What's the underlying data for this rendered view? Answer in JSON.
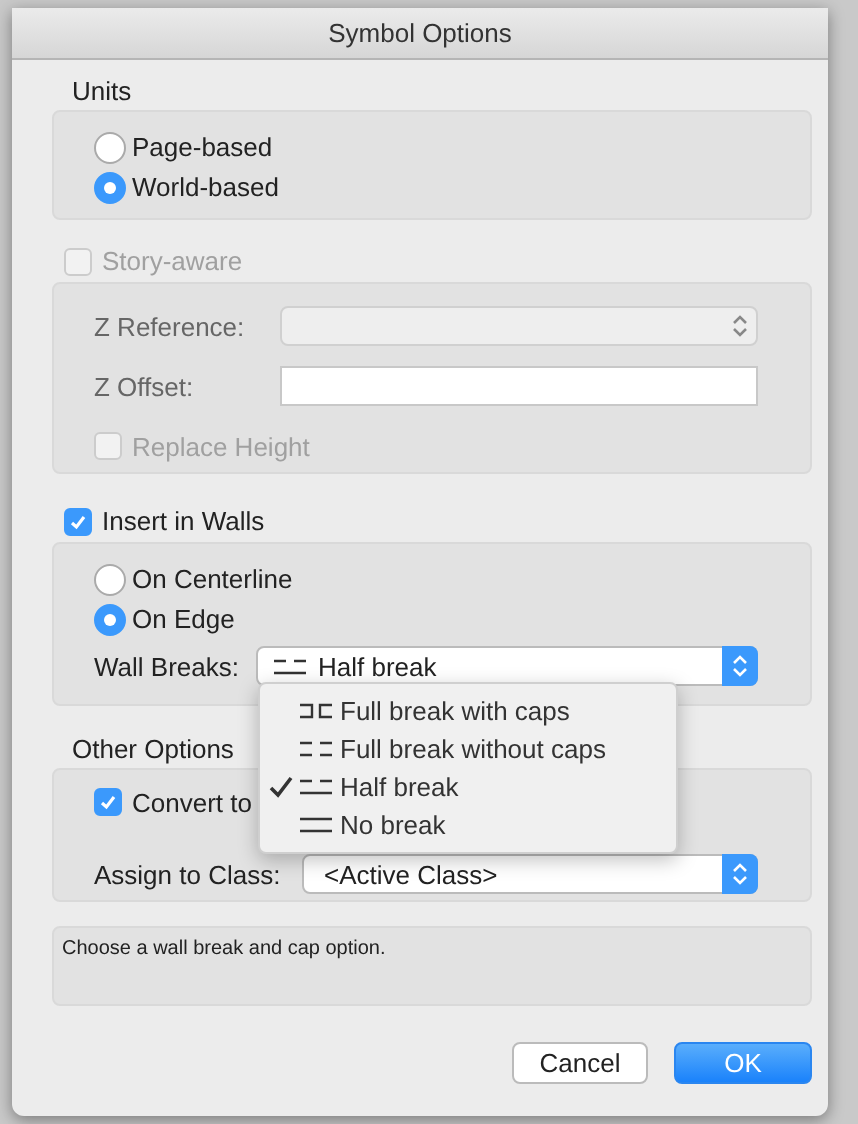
{
  "window": {
    "title": "Symbol Options"
  },
  "units": {
    "label": "Units",
    "options": [
      {
        "label": "Page-based",
        "selected": false
      },
      {
        "label": "World-based",
        "selected": true
      }
    ]
  },
  "story_aware": {
    "label": "Story-aware",
    "checked": false,
    "disabled": true,
    "z_reference": {
      "label": "Z Reference:"
    },
    "z_offset": {
      "label": "Z Offset:"
    },
    "replace_height": {
      "label": "Replace Height",
      "checked": false
    }
  },
  "insert_in_walls": {
    "label": "Insert in Walls",
    "checked": true,
    "placement": [
      {
        "label": "On Centerline",
        "selected": false
      },
      {
        "label": "On Edge",
        "selected": true
      }
    ],
    "wall_breaks": {
      "label": "Wall Breaks:",
      "value": "Half break",
      "expanded": true,
      "options": [
        {
          "label": "Full break with caps",
          "kind": "full_caps",
          "selected": false
        },
        {
          "label": "Full break without caps",
          "kind": "full_nocaps",
          "selected": false
        },
        {
          "label": "Half break",
          "kind": "half",
          "selected": true
        },
        {
          "label": "No break",
          "kind": "none",
          "selected": false
        }
      ]
    }
  },
  "other_options": {
    "label": "Other Options",
    "convert": {
      "label": "Convert to",
      "checked": true
    },
    "assign_class": {
      "label": "Assign to Class:",
      "value": "<Active Class>"
    }
  },
  "help_text": "Choose a wall break and cap option.",
  "buttons": [
    {
      "label": "Cancel",
      "kind": "default"
    },
    {
      "label": "OK",
      "kind": "primary"
    }
  ]
}
